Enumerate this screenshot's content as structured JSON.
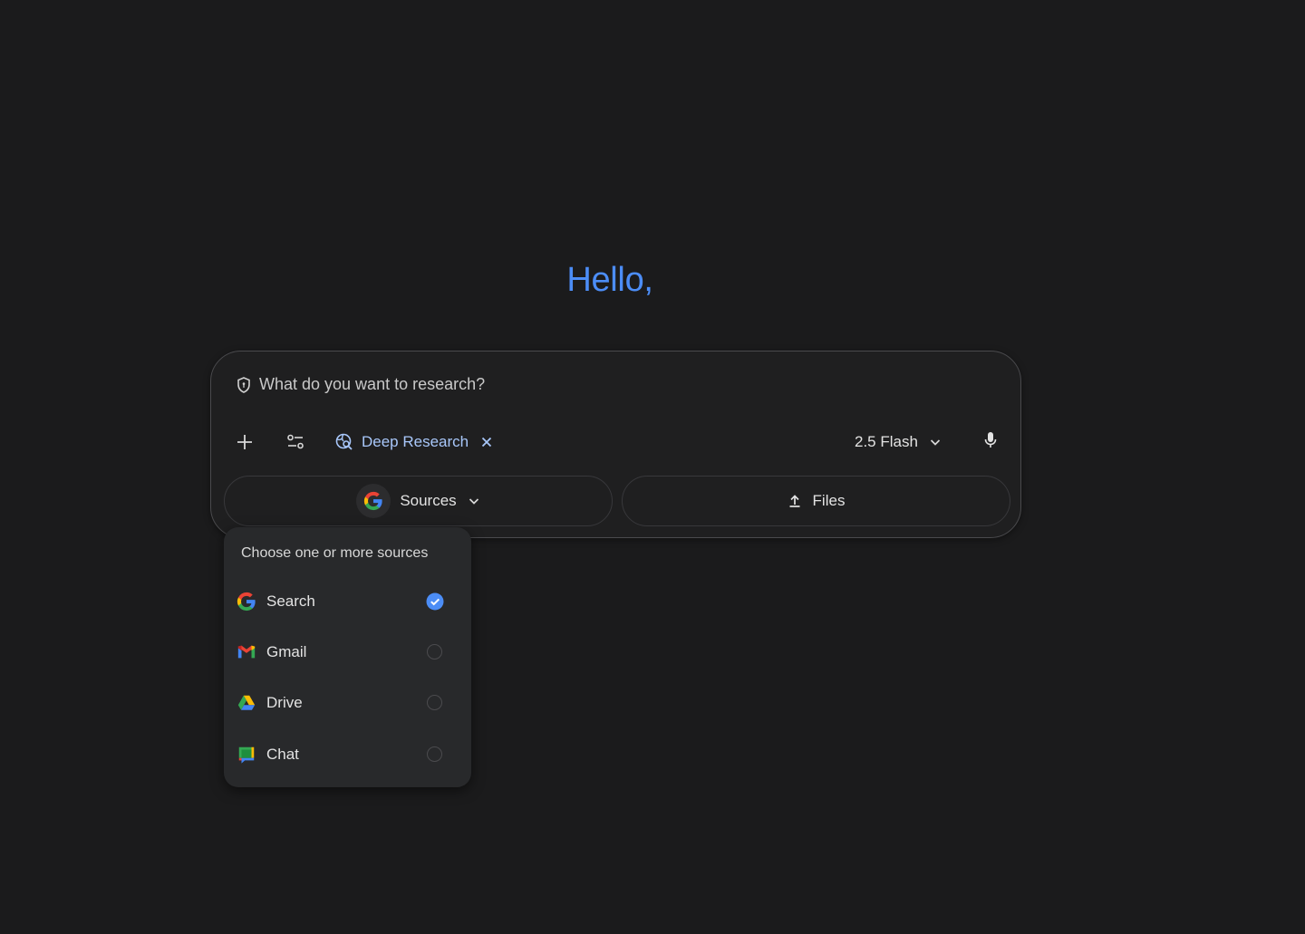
{
  "greeting": "Hello,",
  "composer": {
    "placeholder": "What do you want to research?",
    "deep_research_label": "Deep Research",
    "model_label": "2.5 Flash",
    "sources_label": "Sources",
    "files_label": "Files"
  },
  "sources_menu": {
    "title": "Choose one or more sources",
    "items": [
      {
        "label": "Search",
        "icon": "google-icon",
        "selected": true
      },
      {
        "label": "Gmail",
        "icon": "gmail-icon",
        "selected": false
      },
      {
        "label": "Drive",
        "icon": "drive-icon",
        "selected": false
      },
      {
        "label": "Chat",
        "icon": "chat-icon",
        "selected": false
      }
    ]
  },
  "colors": {
    "background": "#1b1b1c",
    "greeting": "#4c8df6",
    "accent": "#a8c7fa",
    "check": "#4c8df6"
  }
}
